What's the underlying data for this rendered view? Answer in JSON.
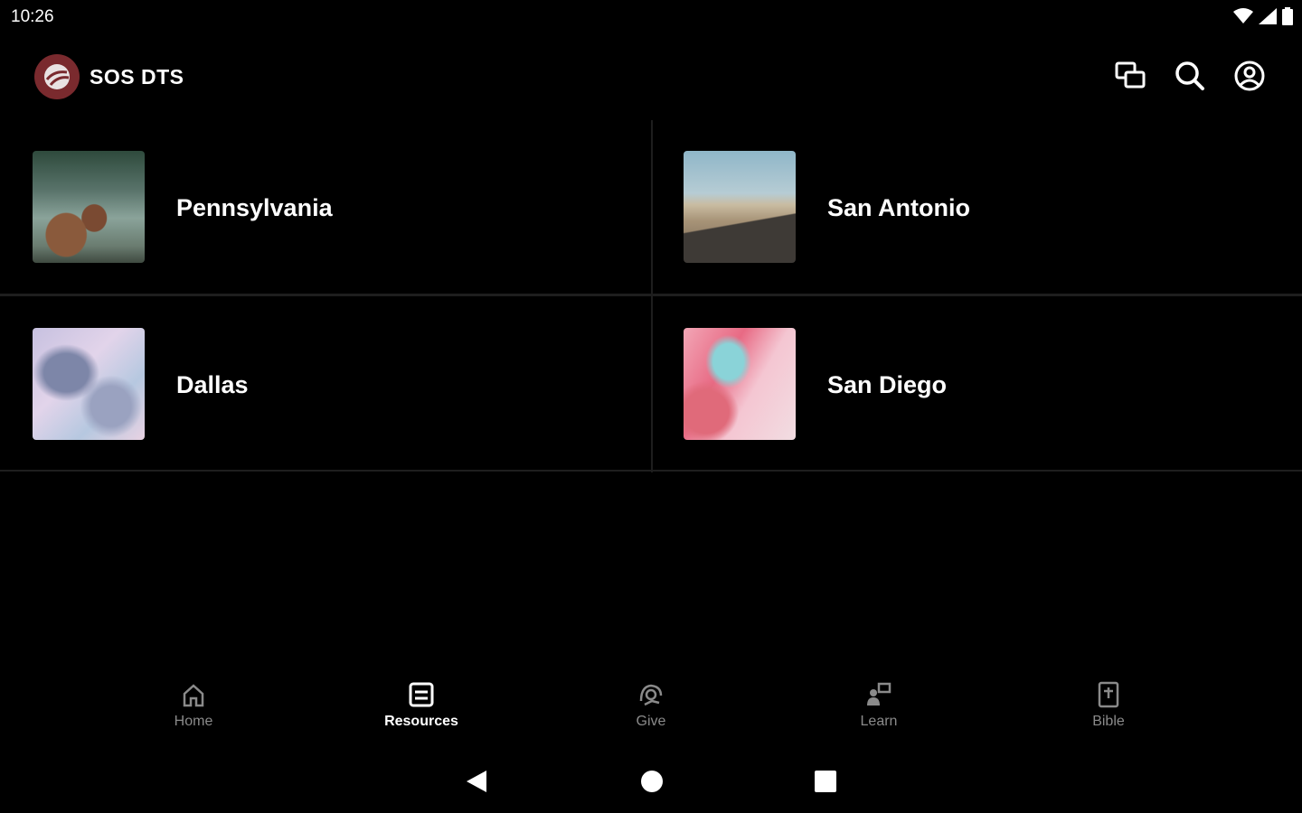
{
  "status": {
    "time": "10:26"
  },
  "app": {
    "name": "SOS DTS"
  },
  "header_actions": [
    "chat-icon",
    "search-icon",
    "account-icon"
  ],
  "tiles": [
    {
      "label": "Pennsylvania"
    },
    {
      "label": "San Antonio"
    },
    {
      "label": "Dallas"
    },
    {
      "label": "San Diego"
    }
  ],
  "bottom_nav": {
    "active": "Resources",
    "items": [
      {
        "label": "Home",
        "icon": "home-icon"
      },
      {
        "label": "Resources",
        "icon": "resources-icon"
      },
      {
        "label": "Give",
        "icon": "give-icon"
      },
      {
        "label": "Learn",
        "icon": "learn-icon"
      },
      {
        "label": "Bible",
        "icon": "bible-icon"
      }
    ]
  },
  "colors": {
    "background": "#000000",
    "brand": "#7a2a2e",
    "inactive_label": "#8a8a8a"
  }
}
